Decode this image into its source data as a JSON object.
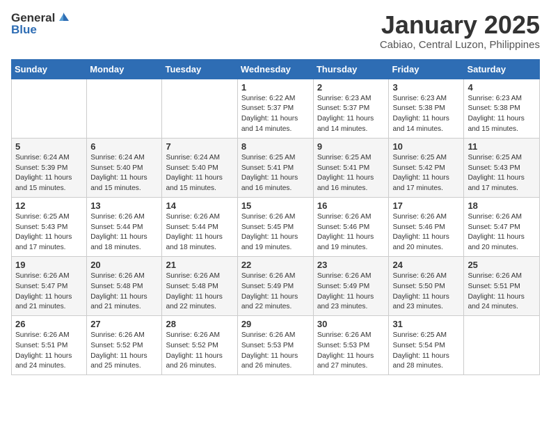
{
  "header": {
    "logo_general": "General",
    "logo_blue": "Blue",
    "month": "January 2025",
    "location": "Cabiao, Central Luzon, Philippines"
  },
  "weekdays": [
    "Sunday",
    "Monday",
    "Tuesday",
    "Wednesday",
    "Thursday",
    "Friday",
    "Saturday"
  ],
  "weeks": [
    [
      {
        "day": "",
        "sunrise": "",
        "sunset": "",
        "daylight": ""
      },
      {
        "day": "",
        "sunrise": "",
        "sunset": "",
        "daylight": ""
      },
      {
        "day": "",
        "sunrise": "",
        "sunset": "",
        "daylight": ""
      },
      {
        "day": "1",
        "sunrise": "Sunrise: 6:22 AM",
        "sunset": "Sunset: 5:37 PM",
        "daylight": "Daylight: 11 hours and 14 minutes."
      },
      {
        "day": "2",
        "sunrise": "Sunrise: 6:23 AM",
        "sunset": "Sunset: 5:37 PM",
        "daylight": "Daylight: 11 hours and 14 minutes."
      },
      {
        "day": "3",
        "sunrise": "Sunrise: 6:23 AM",
        "sunset": "Sunset: 5:38 PM",
        "daylight": "Daylight: 11 hours and 14 minutes."
      },
      {
        "day": "4",
        "sunrise": "Sunrise: 6:23 AM",
        "sunset": "Sunset: 5:38 PM",
        "daylight": "Daylight: 11 hours and 15 minutes."
      }
    ],
    [
      {
        "day": "5",
        "sunrise": "Sunrise: 6:24 AM",
        "sunset": "Sunset: 5:39 PM",
        "daylight": "Daylight: 11 hours and 15 minutes."
      },
      {
        "day": "6",
        "sunrise": "Sunrise: 6:24 AM",
        "sunset": "Sunset: 5:40 PM",
        "daylight": "Daylight: 11 hours and 15 minutes."
      },
      {
        "day": "7",
        "sunrise": "Sunrise: 6:24 AM",
        "sunset": "Sunset: 5:40 PM",
        "daylight": "Daylight: 11 hours and 15 minutes."
      },
      {
        "day": "8",
        "sunrise": "Sunrise: 6:25 AM",
        "sunset": "Sunset: 5:41 PM",
        "daylight": "Daylight: 11 hours and 16 minutes."
      },
      {
        "day": "9",
        "sunrise": "Sunrise: 6:25 AM",
        "sunset": "Sunset: 5:41 PM",
        "daylight": "Daylight: 11 hours and 16 minutes."
      },
      {
        "day": "10",
        "sunrise": "Sunrise: 6:25 AM",
        "sunset": "Sunset: 5:42 PM",
        "daylight": "Daylight: 11 hours and 17 minutes."
      },
      {
        "day": "11",
        "sunrise": "Sunrise: 6:25 AM",
        "sunset": "Sunset: 5:43 PM",
        "daylight": "Daylight: 11 hours and 17 minutes."
      }
    ],
    [
      {
        "day": "12",
        "sunrise": "Sunrise: 6:25 AM",
        "sunset": "Sunset: 5:43 PM",
        "daylight": "Daylight: 11 hours and 17 minutes."
      },
      {
        "day": "13",
        "sunrise": "Sunrise: 6:26 AM",
        "sunset": "Sunset: 5:44 PM",
        "daylight": "Daylight: 11 hours and 18 minutes."
      },
      {
        "day": "14",
        "sunrise": "Sunrise: 6:26 AM",
        "sunset": "Sunset: 5:44 PM",
        "daylight": "Daylight: 11 hours and 18 minutes."
      },
      {
        "day": "15",
        "sunrise": "Sunrise: 6:26 AM",
        "sunset": "Sunset: 5:45 PM",
        "daylight": "Daylight: 11 hours and 19 minutes."
      },
      {
        "day": "16",
        "sunrise": "Sunrise: 6:26 AM",
        "sunset": "Sunset: 5:46 PM",
        "daylight": "Daylight: 11 hours and 19 minutes."
      },
      {
        "day": "17",
        "sunrise": "Sunrise: 6:26 AM",
        "sunset": "Sunset: 5:46 PM",
        "daylight": "Daylight: 11 hours and 20 minutes."
      },
      {
        "day": "18",
        "sunrise": "Sunrise: 6:26 AM",
        "sunset": "Sunset: 5:47 PM",
        "daylight": "Daylight: 11 hours and 20 minutes."
      }
    ],
    [
      {
        "day": "19",
        "sunrise": "Sunrise: 6:26 AM",
        "sunset": "Sunset: 5:47 PM",
        "daylight": "Daylight: 11 hours and 21 minutes."
      },
      {
        "day": "20",
        "sunrise": "Sunrise: 6:26 AM",
        "sunset": "Sunset: 5:48 PM",
        "daylight": "Daylight: 11 hours and 21 minutes."
      },
      {
        "day": "21",
        "sunrise": "Sunrise: 6:26 AM",
        "sunset": "Sunset: 5:48 PM",
        "daylight": "Daylight: 11 hours and 22 minutes."
      },
      {
        "day": "22",
        "sunrise": "Sunrise: 6:26 AM",
        "sunset": "Sunset: 5:49 PM",
        "daylight": "Daylight: 11 hours and 22 minutes."
      },
      {
        "day": "23",
        "sunrise": "Sunrise: 6:26 AM",
        "sunset": "Sunset: 5:49 PM",
        "daylight": "Daylight: 11 hours and 23 minutes."
      },
      {
        "day": "24",
        "sunrise": "Sunrise: 6:26 AM",
        "sunset": "Sunset: 5:50 PM",
        "daylight": "Daylight: 11 hours and 23 minutes."
      },
      {
        "day": "25",
        "sunrise": "Sunrise: 6:26 AM",
        "sunset": "Sunset: 5:51 PM",
        "daylight": "Daylight: 11 hours and 24 minutes."
      }
    ],
    [
      {
        "day": "26",
        "sunrise": "Sunrise: 6:26 AM",
        "sunset": "Sunset: 5:51 PM",
        "daylight": "Daylight: 11 hours and 24 minutes."
      },
      {
        "day": "27",
        "sunrise": "Sunrise: 6:26 AM",
        "sunset": "Sunset: 5:52 PM",
        "daylight": "Daylight: 11 hours and 25 minutes."
      },
      {
        "day": "28",
        "sunrise": "Sunrise: 6:26 AM",
        "sunset": "Sunset: 5:52 PM",
        "daylight": "Daylight: 11 hours and 26 minutes."
      },
      {
        "day": "29",
        "sunrise": "Sunrise: 6:26 AM",
        "sunset": "Sunset: 5:53 PM",
        "daylight": "Daylight: 11 hours and 26 minutes."
      },
      {
        "day": "30",
        "sunrise": "Sunrise: 6:26 AM",
        "sunset": "Sunset: 5:53 PM",
        "daylight": "Daylight: 11 hours and 27 minutes."
      },
      {
        "day": "31",
        "sunrise": "Sunrise: 6:25 AM",
        "sunset": "Sunset: 5:54 PM",
        "daylight": "Daylight: 11 hours and 28 minutes."
      },
      {
        "day": "",
        "sunrise": "",
        "sunset": "",
        "daylight": ""
      }
    ]
  ]
}
